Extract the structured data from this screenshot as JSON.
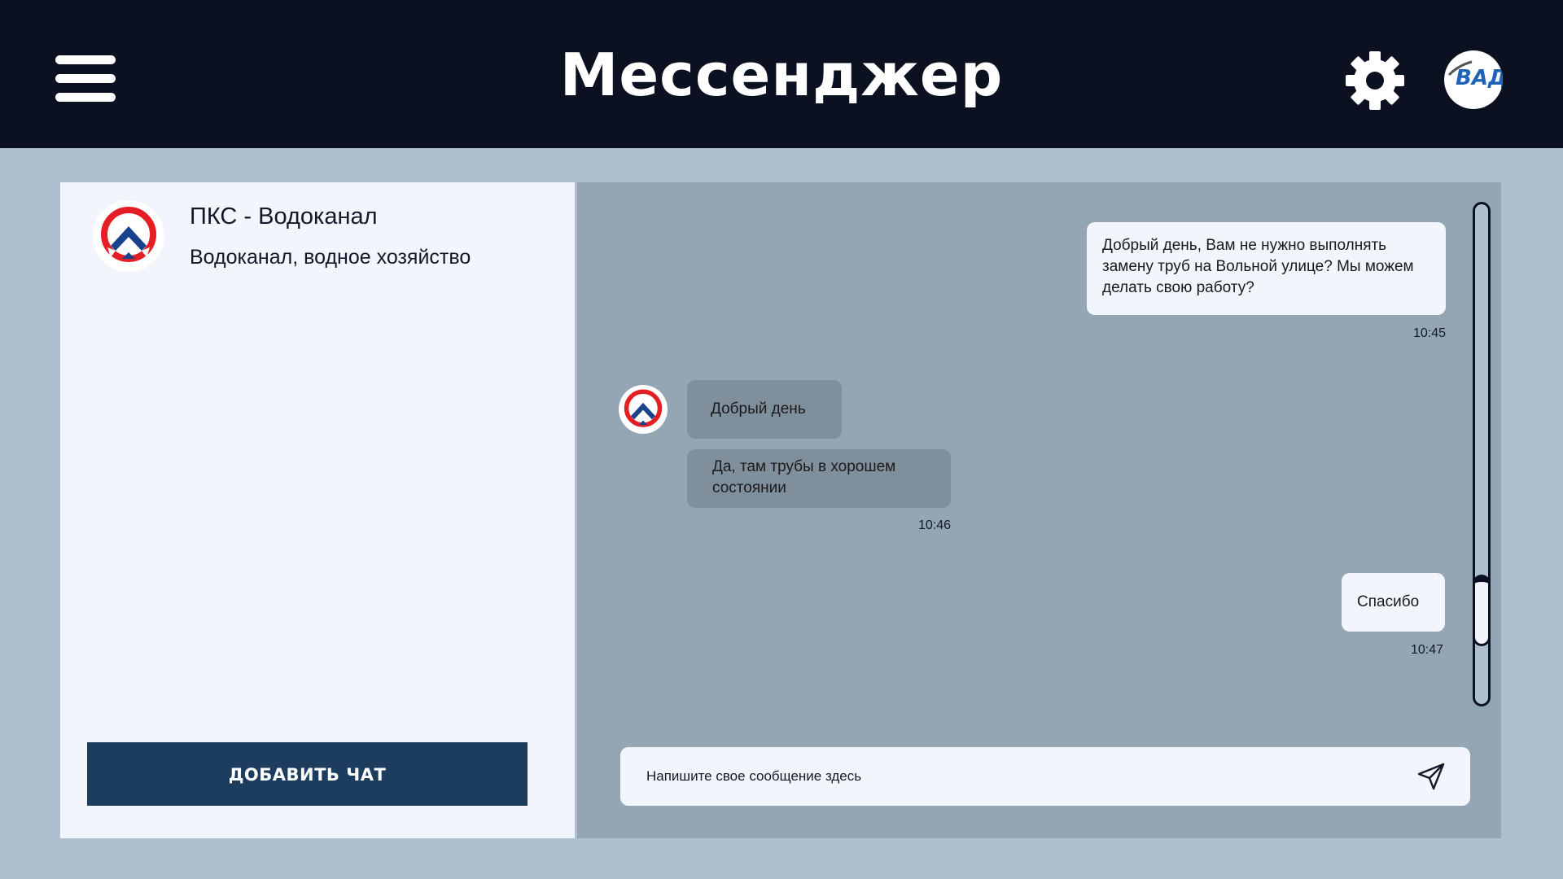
{
  "header": {
    "title": "Мессенджер",
    "menu_icon": "hamburger-menu-icon",
    "settings_icon": "gear-icon",
    "profile_logo_text": "ВАД"
  },
  "sidebar": {
    "chats": [
      {
        "name": "ПКС - Водоканал",
        "category": "Водоканал, водное хозяйство",
        "avatar_icon": "pks-logo-icon"
      }
    ],
    "add_chat_label": "ДОБАВИТЬ ЧАТ"
  },
  "conversation": {
    "messages": [
      {
        "direction": "outgoing",
        "text": "Добрый день, Вам не нужно выполнять замену труб на Вольной улице? Мы можем делать свою работу?",
        "time": "10:45"
      },
      {
        "direction": "incoming",
        "text": "Добрый день"
      },
      {
        "direction": "incoming",
        "text": "Да, там трубы в хорошем состоянии",
        "time": "10:46"
      },
      {
        "direction": "outgoing",
        "text": "Спасибо",
        "time": "10:47"
      }
    ],
    "scroll_position": 0.85
  },
  "composer": {
    "placeholder": "Напишите свое сообщение здесь",
    "value": "",
    "send_icon": "send-paper-plane-icon"
  },
  "colors": {
    "header_bg": "#0b1120",
    "page_bg": "#aebfd0",
    "panel_bg": "#f2f6fc",
    "chat_bg": "#94a6b4",
    "incoming_bubble": "#808f9c",
    "button_bg": "#1c3d5e",
    "logo_red": "#e31e24",
    "logo_blue": "#17428c"
  }
}
